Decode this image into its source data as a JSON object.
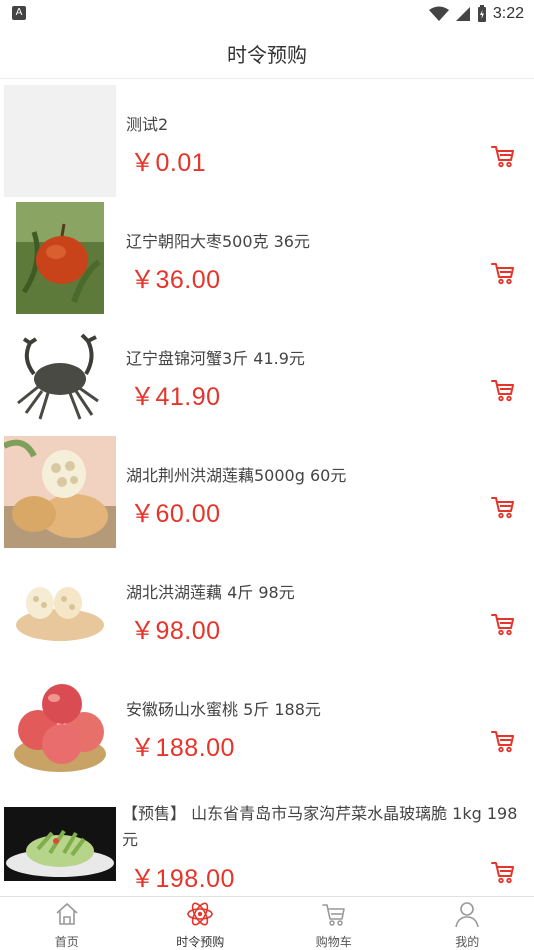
{
  "status_bar": {
    "time": "3:22",
    "notification_icon_letter": "A"
  },
  "header": {
    "title": "时令预购"
  },
  "products": [
    {
      "name": "测试2",
      "price": "￥0.01",
      "image_icon": "blank-placeholder"
    },
    {
      "name": "辽宁朝阳大枣500克 36元",
      "price": "￥36.00",
      "image_icon": "jujube-photo"
    },
    {
      "name": "辽宁盘锦河蟹3斤 41.9元",
      "price": "￥41.90",
      "image_icon": "crab-photo"
    },
    {
      "name": "湖北荆州洪湖莲藕5000g 60元",
      "price": "￥60.00",
      "image_icon": "lotus-root-photo"
    },
    {
      "name": "湖北洪湖莲藕 4斤 98元",
      "price": "￥98.00",
      "image_icon": "lotus-root-photo"
    },
    {
      "name": "安徽砀山水蜜桃 5斤 188元",
      "price": "￥188.00",
      "image_icon": "peach-photo"
    },
    {
      "name": "【预售】 山东省青岛市马家沟芹菜水晶玻璃脆 1kg 198元",
      "price": "￥198.00",
      "image_icon": "celery-salad-photo"
    }
  ],
  "bottom_nav": [
    {
      "label": "首页",
      "icon": "home-icon",
      "active": false
    },
    {
      "label": "时令预购",
      "icon": "atom-icon",
      "active": true
    },
    {
      "label": "购物车",
      "icon": "cart-icon",
      "active": false
    },
    {
      "label": "我的",
      "icon": "user-icon",
      "active": false
    }
  ],
  "colors": {
    "price": "#e5342a",
    "accent": "#e5342a",
    "nav_inactive": "#999999"
  }
}
